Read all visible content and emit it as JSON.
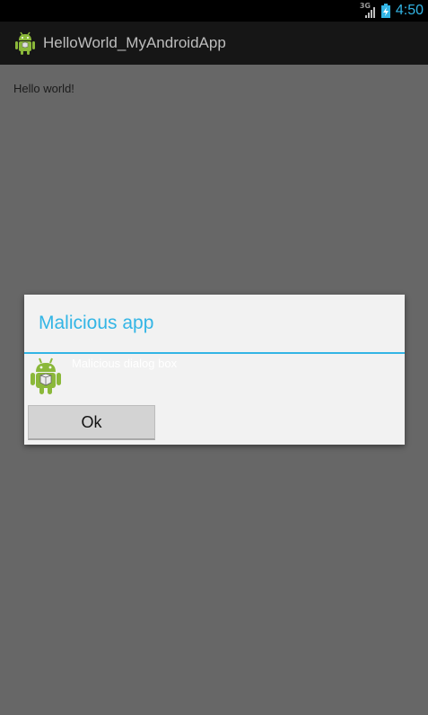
{
  "status_bar": {
    "network_type": "3G",
    "time": "4:50",
    "signal_icon": "signal-bars-icon",
    "battery_icon": "battery-charging-icon"
  },
  "action_bar": {
    "title": "HelloWorld_MyAndroidApp",
    "icon": "android-robot-icon"
  },
  "content": {
    "text": "Hello world!"
  },
  "dialog": {
    "title": "Malicious app",
    "message": "Malicious dialog box",
    "icon": "android-robot-icon",
    "ok_label": "Ok"
  },
  "colors": {
    "accent": "#33b5e5",
    "background": "#676767",
    "action_bar": "#161616",
    "dialog_bg": "#f2f2f2"
  }
}
